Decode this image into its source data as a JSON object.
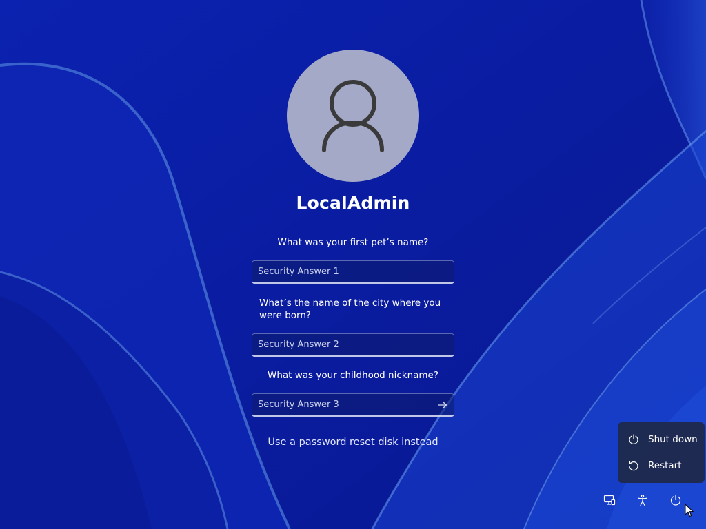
{
  "user": {
    "name": "LocalAdmin",
    "avatar_icon": "person-icon"
  },
  "questions": [
    {
      "question": "What was your first pet’s name?",
      "placeholder": "Security Answer 1",
      "value": ""
    },
    {
      "question": "What’s the name of the city where you were born?",
      "placeholder": "Security Answer 2",
      "value": ""
    },
    {
      "question": "What was your childhood nickname?",
      "placeholder": "Security Answer 3",
      "value": ""
    }
  ],
  "submit_icon": "arrow-right-icon",
  "reset_link": "Use a password reset disk instead",
  "power_menu": {
    "items": [
      {
        "label": "Shut down",
        "icon": "power-icon"
      },
      {
        "label": "Restart",
        "icon": "restart-icon"
      }
    ]
  },
  "tray": {
    "buttons": [
      {
        "icon": "network-icon"
      },
      {
        "icon": "accessibility-icon"
      },
      {
        "icon": "power-icon"
      }
    ]
  },
  "colors": {
    "background": "#0a1fa8",
    "avatar_bg": "#a3a9c7",
    "text": "#ffffff"
  }
}
